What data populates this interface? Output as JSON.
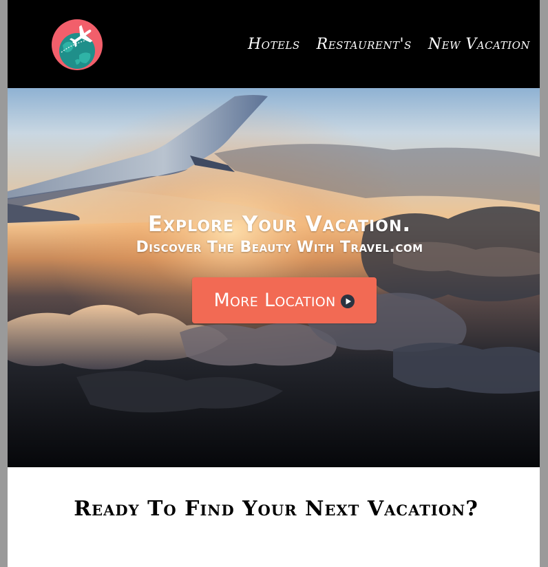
{
  "header": {
    "logo_icon": "globe-airplane-logo-icon",
    "nav": [
      {
        "label": "Hotels"
      },
      {
        "label": "Restaurent's"
      },
      {
        "label": "New Vacation"
      }
    ]
  },
  "hero": {
    "title": "Explore Your Vacation.",
    "subtitle": "Discover The Beauty With Travel.com",
    "cta": {
      "label": "More Location",
      "icon": "play-circle-icon",
      "color": "#f26a54"
    }
  },
  "section": {
    "heading": "Ready To Find Your Next Vacation?"
  },
  "colors": {
    "header_bg": "#000000",
    "accent": "#f26a54",
    "logo_circle": "#f25f6b",
    "globe": "#1f8f8a"
  }
}
